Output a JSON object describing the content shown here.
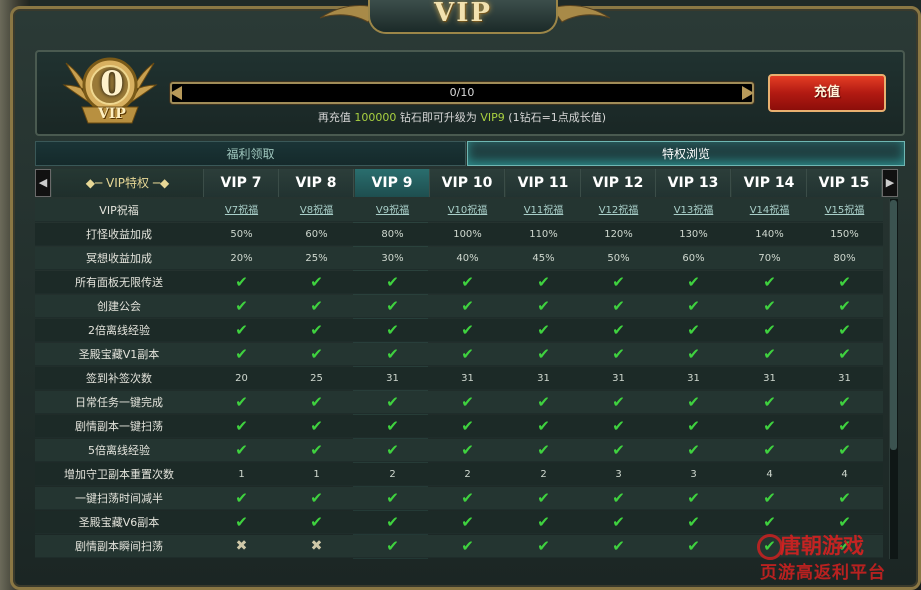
{
  "title": "VIP",
  "badge": {
    "level": "0",
    "label": "VIP"
  },
  "progress": {
    "text": "0/10",
    "fraction": 0
  },
  "hint": {
    "pre": "再充值",
    "amount": "100000",
    "mid": "钻石即可升级为",
    "target": "VIP9",
    "post": "(1钻石=1点成长值)"
  },
  "recharge_label": "充值",
  "tabs": [
    {
      "label": "福利领取"
    },
    {
      "label": "特权浏览"
    }
  ],
  "header": {
    "label": "VIP特权",
    "prev": "◀",
    "next": "▶",
    "columns": [
      "VIP 7",
      "VIP 8",
      "VIP 9",
      "VIP 10",
      "VIP 11",
      "VIP 12",
      "VIP 13",
      "VIP 14",
      "VIP 15"
    ],
    "highlight_index": 2
  },
  "rows": [
    {
      "label": "VIP祝福",
      "type": "link",
      "values": [
        "V7祝福",
        "V8祝福",
        "V9祝福",
        "V10祝福",
        "V11祝福",
        "V12祝福",
        "V13祝福",
        "V14祝福",
        "V15祝福"
      ]
    },
    {
      "label": "打怪收益加成",
      "type": "text",
      "values": [
        "50%",
        "60%",
        "80%",
        "100%",
        "110%",
        "120%",
        "130%",
        "140%",
        "150%"
      ]
    },
    {
      "label": "冥想收益加成",
      "type": "text",
      "values": [
        "20%",
        "25%",
        "30%",
        "40%",
        "45%",
        "50%",
        "60%",
        "70%",
        "80%"
      ]
    },
    {
      "label": "所有面板无限传送",
      "type": "mark",
      "values": [
        "✔",
        "✔",
        "✔",
        "✔",
        "✔",
        "✔",
        "✔",
        "✔",
        "✔"
      ]
    },
    {
      "label": "创建公会",
      "type": "mark",
      "values": [
        "✔",
        "✔",
        "✔",
        "✔",
        "✔",
        "✔",
        "✔",
        "✔",
        "✔"
      ]
    },
    {
      "label": "2倍离线经验",
      "type": "mark",
      "values": [
        "✔",
        "✔",
        "✔",
        "✔",
        "✔",
        "✔",
        "✔",
        "✔",
        "✔"
      ]
    },
    {
      "label": "圣殿宝藏V1副本",
      "type": "mark",
      "values": [
        "✔",
        "✔",
        "✔",
        "✔",
        "✔",
        "✔",
        "✔",
        "✔",
        "✔"
      ]
    },
    {
      "label": "签到补签次数",
      "type": "text",
      "values": [
        "20",
        "25",
        "31",
        "31",
        "31",
        "31",
        "31",
        "31",
        "31"
      ]
    },
    {
      "label": "日常任务一键完成",
      "type": "mark",
      "values": [
        "✔",
        "✔",
        "✔",
        "✔",
        "✔",
        "✔",
        "✔",
        "✔",
        "✔"
      ]
    },
    {
      "label": "剧情副本一键扫荡",
      "type": "mark",
      "values": [
        "✔",
        "✔",
        "✔",
        "✔",
        "✔",
        "✔",
        "✔",
        "✔",
        "✔"
      ]
    },
    {
      "label": "5倍离线经验",
      "type": "mark",
      "values": [
        "✔",
        "✔",
        "✔",
        "✔",
        "✔",
        "✔",
        "✔",
        "✔",
        "✔"
      ]
    },
    {
      "label": "增加守卫副本重置次数",
      "type": "text",
      "values": [
        "1",
        "1",
        "2",
        "2",
        "2",
        "3",
        "3",
        "4",
        "4"
      ]
    },
    {
      "label": "一键扫荡时间减半",
      "type": "mark",
      "values": [
        "✔",
        "✔",
        "✔",
        "✔",
        "✔",
        "✔",
        "✔",
        "✔",
        "✔"
      ]
    },
    {
      "label": "圣殿宝藏V6副本",
      "type": "mark",
      "values": [
        "✔",
        "✔",
        "✔",
        "✔",
        "✔",
        "✔",
        "✔",
        "✔",
        "✔"
      ]
    },
    {
      "label": "剧情副本瞬间扫荡",
      "type": "mark",
      "values": [
        "✖",
        "✖",
        "✔",
        "✔",
        "✔",
        "✔",
        "✔",
        "✔",
        "✔"
      ]
    }
  ],
  "watermark": {
    "line1": "唐朝游戏",
    "line2": "页游高返利平台"
  },
  "colors": {
    "check": "#3fd23f",
    "cross": "#cfc8a8",
    "accent": "#e8d896",
    "recharge": "#c62618"
  }
}
